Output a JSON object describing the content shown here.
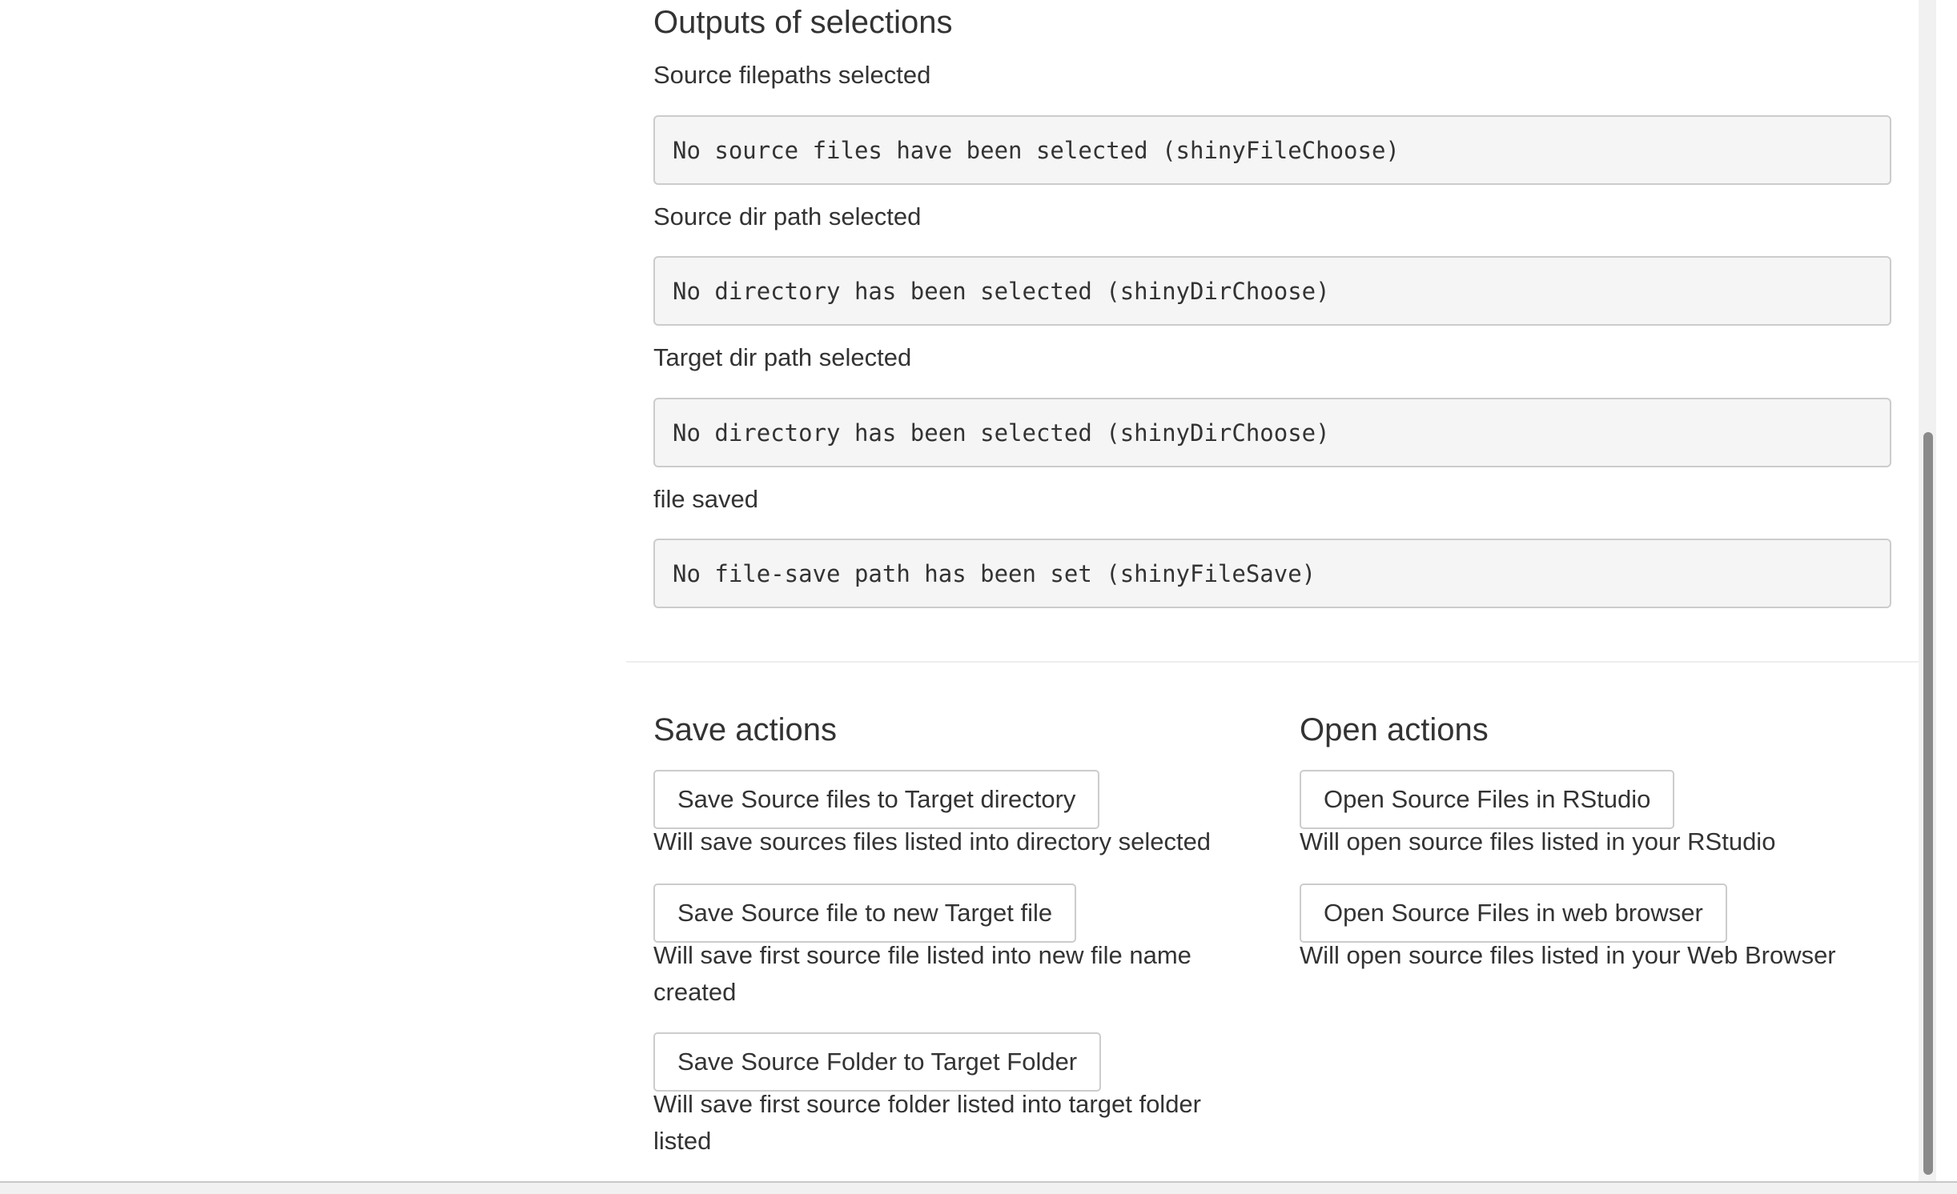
{
  "outputs": {
    "title": "Outputs of selections",
    "items": [
      {
        "label": "Source filepaths selected",
        "value": "No source files have been selected (shinyFileChoose)"
      },
      {
        "label": "Source dir path selected",
        "value": "No directory has been selected (shinyDirChoose)"
      },
      {
        "label": "Target dir path selected",
        "value": "No directory has been selected (shinyDirChoose)"
      },
      {
        "label": "file saved",
        "value": "No file-save path has been set (shinyFileSave)"
      }
    ]
  },
  "save_actions": {
    "title": "Save actions",
    "buttons": [
      {
        "label": "Save Source files to Target directory",
        "help": "Will save sources files listed into directory selected"
      },
      {
        "label": "Save Source file to new Target file",
        "help": "Will save first source file listed into new file name created"
      },
      {
        "label": "Save Source Folder to Target Folder",
        "help": "Will save first source folder listed into target folder listed"
      }
    ]
  },
  "open_actions": {
    "title": "Open actions",
    "buttons": [
      {
        "label": "Open Source Files in RStudio",
        "help": "Will open source files listed in your RStudio"
      },
      {
        "label": "Open Source Files in web browser",
        "help": "Will open source files listed in your Web Browser"
      }
    ]
  }
}
